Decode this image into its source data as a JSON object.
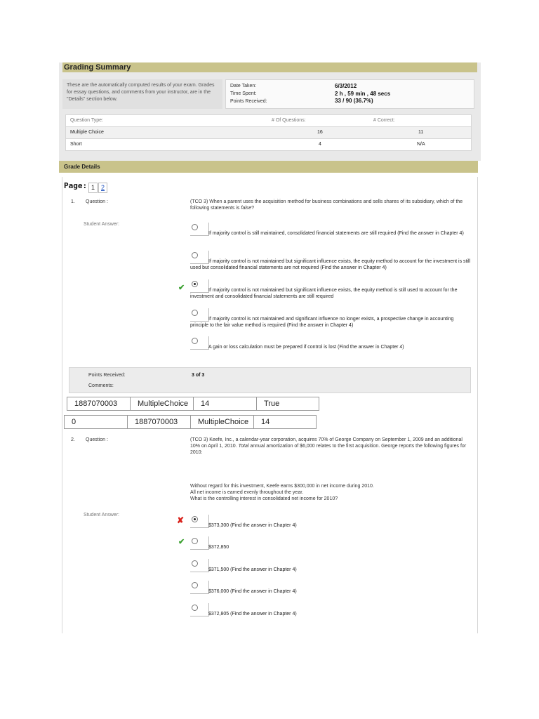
{
  "grading_summary": {
    "title": "Grading Summary",
    "intro": "These are the automatically computed results of your exam. Grades for essay questions, and comments from your instructor, are in the \"Details\" section below.",
    "date_taken_label": "Date Taken:",
    "date_taken": "6/3/2012",
    "time_spent_label": "Time Spent:",
    "time_spent": "2 h , 59 min , 48 secs",
    "points_received_label": "Points Received:",
    "points_received": "33 / 90  (36.7%)",
    "table": {
      "headers": [
        "Question Type:",
        "# Of Questions:",
        "# Correct:"
      ],
      "rows": [
        [
          "Multiple Choice",
          "16",
          "11"
        ],
        [
          "Short",
          "4",
          "N/A"
        ]
      ]
    }
  },
  "grade_details": {
    "title": "Grade Details",
    "page_label": "Page:",
    "pages": [
      "1",
      "2"
    ]
  },
  "question1": {
    "number": "1.",
    "label": "Question :",
    "text_a": "(TCO 3) When a parent uses the acquisition method for business combinations and sells shares of its subsidiary, which of the following statements is ",
    "text_em": "false",
    "text_b": "?",
    "student_answer_label": "Student Answer:",
    "options": [
      "If majority control is still maintained, consolidated financial statements are still required (Find the answer in Chapter 4)",
      "If majority control is not maintained but significant influence exists, the equity method to account for the investment is still used but consolidated financial statements are not required (Find the answer in Chapter 4)",
      "If majority control is not maintained but significant influence exists, the equity method is still used to account for the investment and consolidated financial statements are still required",
      "If majority control is not maintained and significant influence no longer exists, a prospective change in accounting principle to the fair value method is required (Find the answer in Chapter 4)",
      "A gain or loss calculation must be prepared if control is lost (Find the answer in Chapter 4)"
    ],
    "points_label": "Points Received:",
    "points": "3 of 3",
    "comments_label": "Comments:"
  },
  "meta_row1": [
    "1887070003",
    "MultipleChoice",
    "14",
    "True"
  ],
  "meta_row2": [
    "0",
    "1887070003",
    "MultipleChoice",
    "14"
  ],
  "question2": {
    "number": "2.",
    "label": "Question :",
    "text_a": "(TCO 3) Keefe, Inc., a calendar-year corporation, acquires 70% of George Company on September 1, 2009 and an additional 10% on April 1, 2010. ",
    "text_em": "Total",
    "text_b": " annual amortization of $6,000 relates to the first acquisition. George reports the following figures for 2010:",
    "text2_line1": "Without regard for this investment, Keefe earns $300,000 in net income during 2010.",
    "text2_line2": "All net income is earned evenly throughout the year.",
    "text2_line3": "What is the controlling interest in consolidated net income for 2010?",
    "student_answer_label": "Student Answer:",
    "options": [
      "$373,300 (Find the answer in Chapter 4)",
      "$372,850",
      "$371,500 (Find the answer in Chapter 4)",
      "$376,000 (Find the answer in Chapter 4)",
      "$372,805 (Find the answer in Chapter 4)"
    ]
  },
  "icons": {
    "correct": "✔",
    "incorrect": "✘",
    "correct_color": "#3aa02f",
    "incorrect_color": "#d9221b",
    "header_color": "#c9c38b"
  }
}
